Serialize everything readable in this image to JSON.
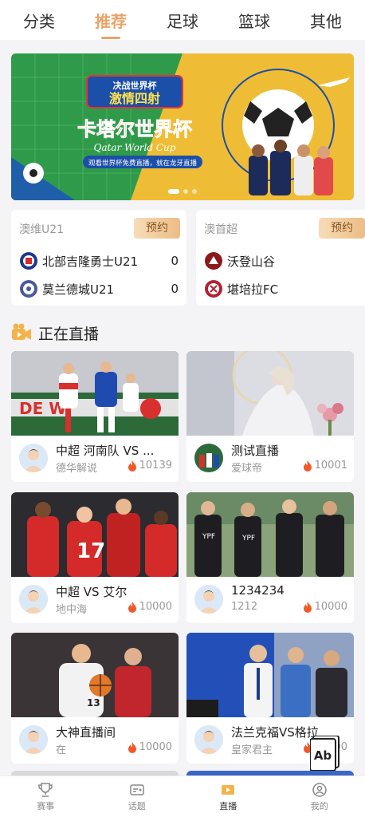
{
  "top_tabs": [
    {
      "label": "分类"
    },
    {
      "label": "推荐"
    },
    {
      "label": "足球"
    },
    {
      "label": "篮球"
    },
    {
      "label": "其他"
    }
  ],
  "active_tab": "推荐",
  "banner": {
    "line1": "决战世界杯",
    "line2": "激情四射",
    "headline": "卡塔尔世界杯",
    "subtitle_en": "Qatar World Cup",
    "slogan": "观看世界杯免费直播，就在龙牙直播",
    "pages": 3,
    "active_page": 1
  },
  "matches": [
    {
      "league": "澳维U21",
      "book_label": "预约",
      "home": {
        "name": "北部吉隆勇士U21",
        "score": "0",
        "logo_color": "#1c3a8c"
      },
      "away": {
        "name": "莫兰德城U21",
        "score": "0",
        "logo_color": "#4a5a9a"
      }
    },
    {
      "league": "澳首超",
      "book_label": "预约",
      "home": {
        "name": "沃登山谷",
        "score": "",
        "logo_color": "#8b1a1a"
      },
      "away": {
        "name": "堪培拉FC",
        "score": "",
        "logo_color": "#b22234"
      }
    }
  ],
  "section": {
    "title": "正在直播"
  },
  "live": [
    {
      "title": "中超 河南队 VS ...",
      "anchor": "德华解说",
      "heat": "10139",
      "thumb": "football-red-blue"
    },
    {
      "title": "测试直播",
      "anchor": "爱球帝",
      "heat": "10001",
      "thumb": "model-photo"
    },
    {
      "title": "中超 VS 艾尔",
      "anchor": "地中海",
      "heat": "10000",
      "thumb": "football-celebration"
    },
    {
      "title": "1234234",
      "anchor": "1212",
      "heat": "10000",
      "thumb": "football-team-black"
    },
    {
      "title": "大神直播间",
      "anchor": "在",
      "heat": "10000",
      "thumb": "basketball"
    },
    {
      "title": "法兰克福VS格拉",
      "anchor": "皇家君主",
      "heat": "10000",
      "thumb": "football-coach"
    }
  ],
  "bottom_nav": [
    {
      "label": "赛事",
      "icon": "trophy-icon"
    },
    {
      "label": "话题",
      "icon": "topic-icon"
    },
    {
      "label": "直播",
      "icon": "live-play-icon"
    },
    {
      "label": "我的",
      "icon": "profile-icon"
    }
  ],
  "colors": {
    "accent": "#e9a46a",
    "accent_dark": "#8a5523",
    "flame": "#f05a28"
  }
}
